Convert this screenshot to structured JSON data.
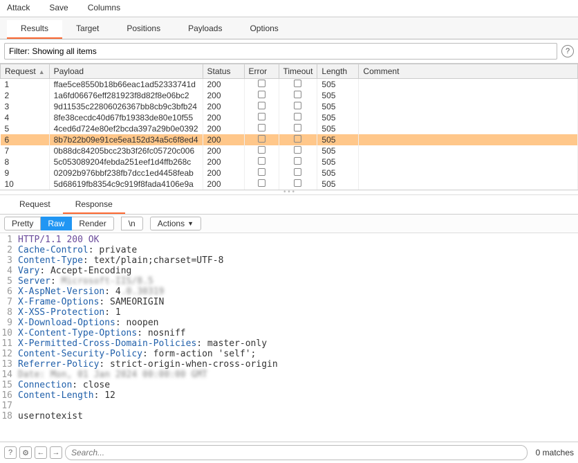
{
  "menu": {
    "attack": "Attack",
    "save": "Save",
    "columns": "Columns"
  },
  "tabs": {
    "results": "Results",
    "target": "Target",
    "positions": "Positions",
    "payloads": "Payloads",
    "options": "Options"
  },
  "filter": {
    "value": "Filter: Showing all items"
  },
  "cols": {
    "request": "Request",
    "payload": "Payload",
    "status": "Status",
    "error": "Error",
    "timeout": "Timeout",
    "length": "Length",
    "comment": "Comment"
  },
  "rows": [
    {
      "req": "1",
      "pay": "ffae5ce8550b18b66eac1ad52333741d",
      "st": "200",
      "len": "505"
    },
    {
      "req": "2",
      "pay": "1a6fd06676eff281923f8d82f8e06bc2",
      "st": "200",
      "len": "505"
    },
    {
      "req": "3",
      "pay": "9d11535c22806026367bb8cb9c3bfb24",
      "st": "200",
      "len": "505"
    },
    {
      "req": "4",
      "pay": "8fe38cecdc40d67fb19383de80e10f55",
      "st": "200",
      "len": "505"
    },
    {
      "req": "5",
      "pay": "4ced6d724e80ef2bcda397a29b0e0392",
      "st": "200",
      "len": "505"
    },
    {
      "req": "6",
      "pay": "8b7b22b09e91ce5ea152d34a5c6f8ed4",
      "st": "200",
      "len": "505",
      "sel": true
    },
    {
      "req": "7",
      "pay": "0b88dc84205bcc23b3f26fc05720c006",
      "st": "200",
      "len": "505"
    },
    {
      "req": "8",
      "pay": "5c053089204febda251eef1d4ffb268c",
      "st": "200",
      "len": "505"
    },
    {
      "req": "9",
      "pay": "02092b976bbf238fb7dcc1ed4458feab",
      "st": "200",
      "len": "505"
    },
    {
      "req": "10",
      "pay": "5d68619fb8354c9c919f8fada4106e9a",
      "st": "200",
      "len": "505"
    }
  ],
  "detail_tabs": {
    "request": "Request",
    "response": "Response"
  },
  "viewbar": {
    "pretty": "Pretty",
    "raw": "Raw",
    "render": "Render",
    "newline": "\\n",
    "actions": "Actions"
  },
  "response_lines": [
    {
      "n": "1",
      "header": "",
      "val": "HTTP/1.1 200 OK",
      "status": true
    },
    {
      "n": "2",
      "header": "Cache-Control",
      "val": ": private"
    },
    {
      "n": "3",
      "header": "Content-Type",
      "val": ": text/plain;charset=UTF-8"
    },
    {
      "n": "4",
      "header": "Vary",
      "val": ": Accept-Encoding"
    },
    {
      "n": "5",
      "header": "Server",
      "val": ": ",
      "blur": "Microsoft-IIS/8.5"
    },
    {
      "n": "6",
      "header": "X-AspNet-Version",
      "val": ": 4",
      "blur": ".0.30319"
    },
    {
      "n": "7",
      "header": "X-Frame-Options",
      "val": ": SAMEORIGIN"
    },
    {
      "n": "8",
      "header": "X-XSS-Protection",
      "val": ": 1"
    },
    {
      "n": "9",
      "header": "X-Download-Options",
      "val": ": noopen"
    },
    {
      "n": "10",
      "header": "X-Content-Type-Options",
      "val": ": nosniff"
    },
    {
      "n": "11",
      "header": "X-Permitted-Cross-Domain-Policies",
      "val": ": master-only"
    },
    {
      "n": "12",
      "header": "Content-Security-Policy",
      "val": ": form-action 'self';"
    },
    {
      "n": "13",
      "header": "Referrer-Policy",
      "val": ": strict-origin-when-cross-origin"
    },
    {
      "n": "14",
      "header": "",
      "val": "",
      "blur": "Date: Mon, 01 Jan 2024 00:00:00 GMT"
    },
    {
      "n": "15",
      "header": "Connection",
      "val": ": close"
    },
    {
      "n": "16",
      "header": "Content-Length",
      "val": ": 12"
    },
    {
      "n": "17",
      "header": "",
      "val": ""
    },
    {
      "n": "18",
      "header": "",
      "val": "usernotexist"
    }
  ],
  "bottom": {
    "search_placeholder": "Search...",
    "matches": "0 matches"
  }
}
